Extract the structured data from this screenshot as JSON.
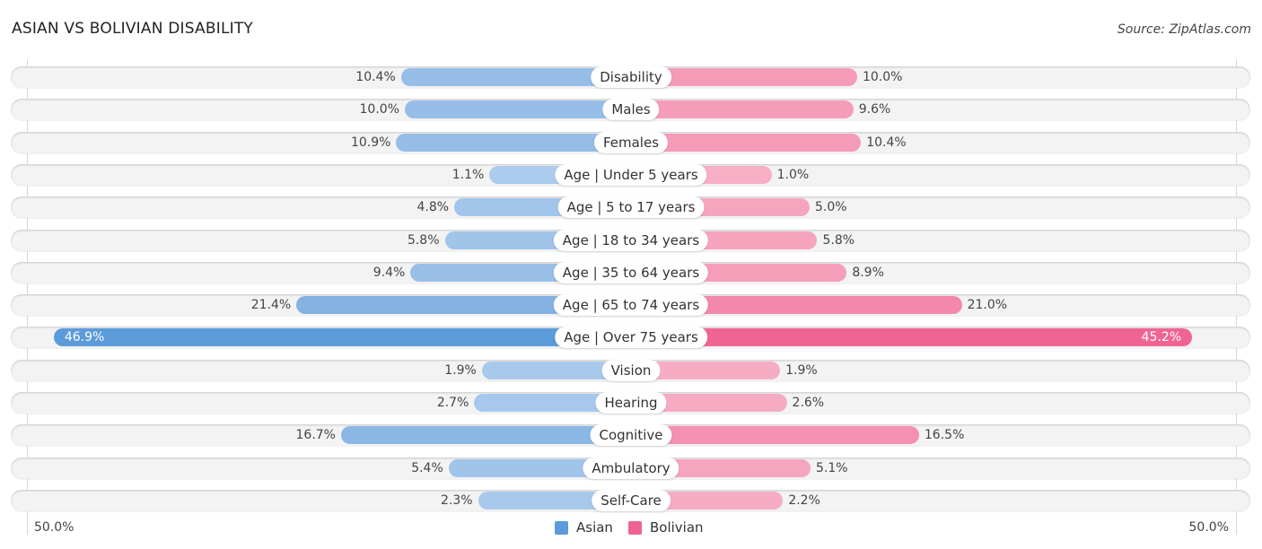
{
  "header": {
    "title": "ASIAN VS BOLIVIAN DISABILITY",
    "source": "Source: ZipAtlas.com"
  },
  "chart_data": {
    "type": "bar",
    "orientation": "horizontal-diverging",
    "title": "ASIAN VS BOLIVIAN DISABILITY",
    "categories": [
      "Disability",
      "Males",
      "Females",
      "Age | Under 5 years",
      "Age | 5 to 17 years",
      "Age | 18 to 34 years",
      "Age | 35 to 64 years",
      "Age | 65 to 74 years",
      "Age | Over 75 years",
      "Vision",
      "Hearing",
      "Cognitive",
      "Ambulatory",
      "Self-Care"
    ],
    "series": [
      {
        "name": "Asian",
        "side": "left",
        "color": "#5b9bd9",
        "values": [
          10.4,
          10.0,
          10.9,
          1.1,
          4.8,
          5.8,
          9.4,
          21.4,
          46.9,
          1.9,
          2.7,
          16.7,
          5.4,
          2.3
        ],
        "labels": [
          "10.4%",
          "10.0%",
          "10.9%",
          "1.1%",
          "4.8%",
          "5.8%",
          "9.4%",
          "21.4%",
          "46.9%",
          "1.9%",
          "2.7%",
          "16.7%",
          "5.4%",
          "2.3%"
        ]
      },
      {
        "name": "Bolivian",
        "side": "right",
        "color": "#f06292",
        "values": [
          10.0,
          9.6,
          10.4,
          1.0,
          5.0,
          5.8,
          8.9,
          21.0,
          45.2,
          1.9,
          2.6,
          16.5,
          5.1,
          2.2
        ],
        "labels": [
          "10.0%",
          "9.6%",
          "10.4%",
          "1.0%",
          "5.0%",
          "5.8%",
          "8.9%",
          "21.0%",
          "45.2%",
          "1.9%",
          "2.6%",
          "16.5%",
          "5.1%",
          "2.2%"
        ]
      }
    ],
    "xlim": [
      0,
      50
    ],
    "axis_labels": {
      "left": "50.0%",
      "right": "50.0%"
    },
    "legend": {
      "position": "bottom-center",
      "entries": [
        "Asian",
        "Bolivian"
      ]
    },
    "grid": false,
    "unit": "%"
  }
}
